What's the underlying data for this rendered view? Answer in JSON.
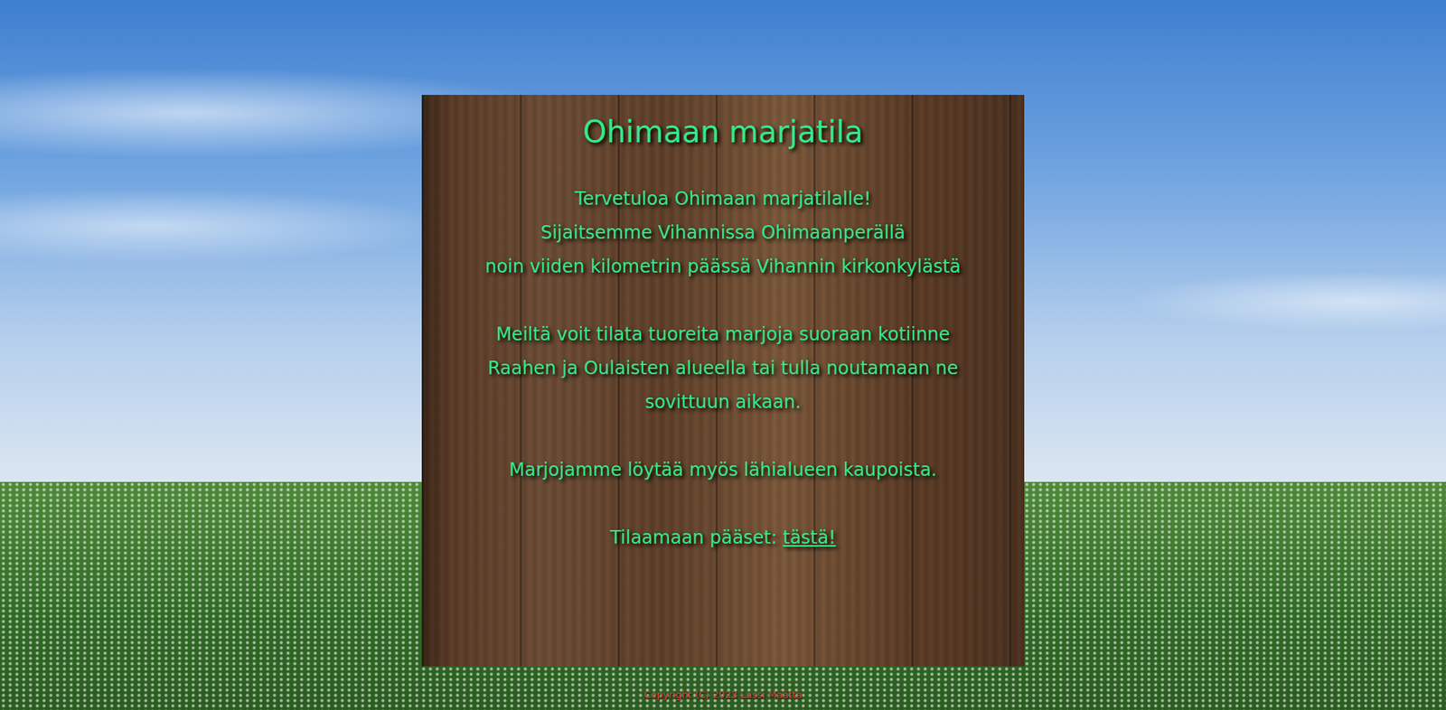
{
  "page": {
    "title": "Ohimaan marjatila",
    "paragraphs": [
      [
        "Tervetuloa Ohimaan marjatilalle!",
        "Sijaitsemme Vihannissa Ohimaanperällä",
        "noin viiden kilometrin päässä Vihannin kirkonkylästä"
      ],
      [
        "Meiltä voit tilata tuoreita marjoja suoraan kotiinne",
        "Raahen ja Oulaisten alueella tai tulla noutamaan ne",
        "sovittuun aikaan."
      ],
      [
        "Marjojamme löytää myös lähialueen kaupoista."
      ]
    ],
    "order": {
      "label": "Tilaamaan pääset: ",
      "link": "tästä!"
    }
  },
  "footer": "Copyright (C) 2023 Lassi Määttä"
}
